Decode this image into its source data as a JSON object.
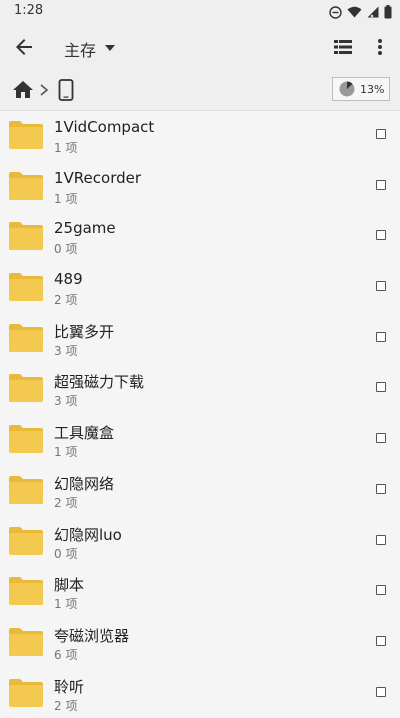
{
  "status_bar": {
    "time": "1:28"
  },
  "toolbar": {
    "title": "主存"
  },
  "path_bar": {
    "storage_usage": "13%",
    "storage_fraction": 0.13
  },
  "folders": [
    {
      "name": "1VidCompact",
      "count": "1 项"
    },
    {
      "name": "1VRecorder",
      "count": "1 项"
    },
    {
      "name": "25game",
      "count": "0 项"
    },
    {
      "name": "489",
      "count": "2 项"
    },
    {
      "name": "比翼多开",
      "count": "3 项"
    },
    {
      "name": "超强磁力下载",
      "count": "3 项"
    },
    {
      "name": "工具魔盒",
      "count": "1 项"
    },
    {
      "name": "幻隐网络",
      "count": "2 项"
    },
    {
      "name": "幻隐网luo",
      "count": "0 项"
    },
    {
      "name": "脚本",
      "count": "1 项"
    },
    {
      "name": "夸磁浏览器",
      "count": "6 项"
    },
    {
      "name": "聆听",
      "count": "2 项"
    }
  ],
  "colors": {
    "folder": "#f4c94f",
    "folder_tab": "#e8b93a",
    "background": "#f5f5f5",
    "bar": "#efefef"
  }
}
